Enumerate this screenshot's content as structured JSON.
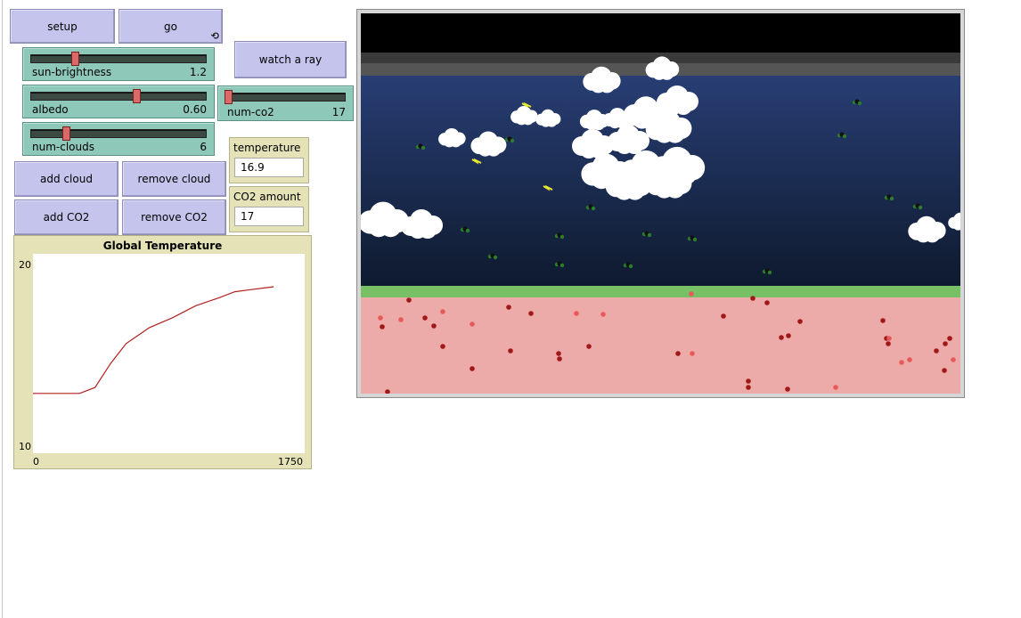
{
  "buttons": {
    "setup": "setup",
    "go": "go",
    "go_icon": "forever-icon",
    "watch_ray": "watch a ray",
    "add_cloud": "add cloud",
    "remove_cloud": "remove cloud",
    "add_co2": "add CO2",
    "remove_co2": "remove CO2"
  },
  "sliders": {
    "sun_brightness": {
      "label": "sun-brightness",
      "value": "1.2",
      "fraction": 0.25
    },
    "albedo": {
      "label": "albedo",
      "value": "0.60",
      "fraction": 0.6
    },
    "num_clouds": {
      "label": "num-clouds",
      "value": "6",
      "fraction": 0.2
    },
    "num_co2": {
      "label": "num-co2",
      "value": "17",
      "fraction": 0.02
    }
  },
  "monitors": {
    "temperature": {
      "label": "temperature",
      "value": "16.9"
    },
    "co2_amount": {
      "label": "CO2 amount",
      "value": "17"
    }
  },
  "plot": {
    "title": "Global Temperature",
    "x_min": "0",
    "x_max": "1750",
    "y_min": "10",
    "y_max": "20"
  },
  "chart_data": {
    "type": "line",
    "title": "Global Temperature",
    "xlabel": "",
    "ylabel": "",
    "xlim": [
      0,
      1750
    ],
    "ylim": [
      10,
      20
    ],
    "series": [
      {
        "color": "#b22020",
        "x": [
          0,
          300,
          400,
          500,
          600,
          750,
          900,
          1050,
          1200,
          1300,
          1400,
          1500,
          1550,
          1400
        ],
        "y": [
          13.0,
          13.0,
          13.3,
          14.5,
          15.5,
          16.3,
          16.8,
          17.4,
          17.8,
          18.1,
          18.2,
          18.3,
          18.35,
          18.3
        ]
      }
    ]
  },
  "world": {
    "colors": {
      "space": "#000000",
      "atmosphere_band": "#555555",
      "sky_top": "#283e74",
      "sky_bottom": "#0e1a2e",
      "surface": "#78c066",
      "earth": "#ecaaa8",
      "heat_dark": "#a01818",
      "heat_light": "#e85a5a",
      "co2": "#2d7d2d",
      "sun_ray": "#e8e832"
    }
  }
}
